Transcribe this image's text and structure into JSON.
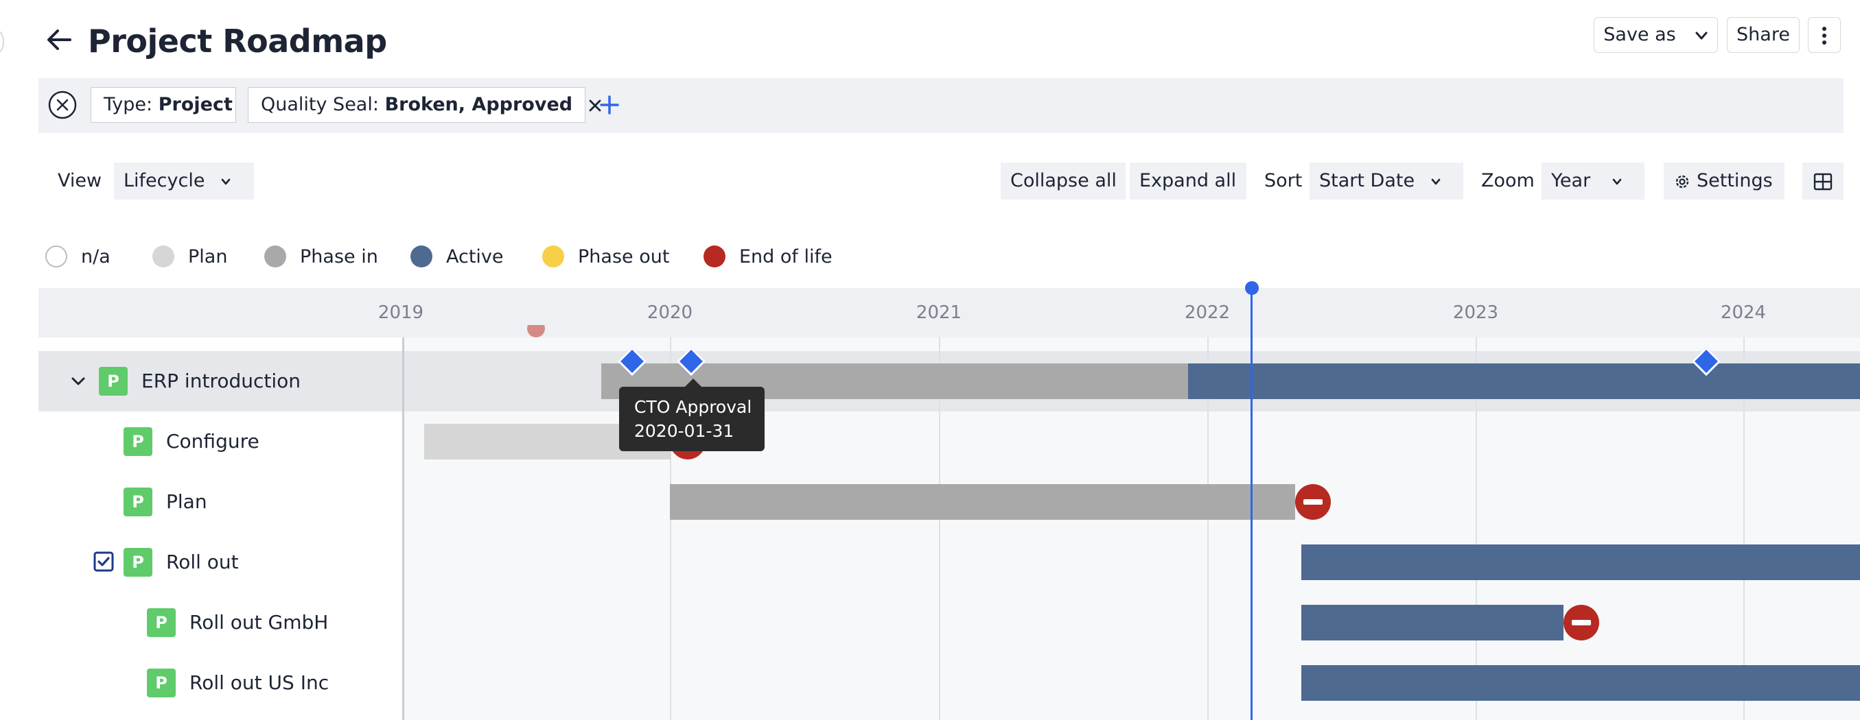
{
  "header": {
    "title": "Project Roadmap",
    "save_as": "Save as",
    "share": "Share"
  },
  "filters": [
    {
      "key": "Type:",
      "value": "Project"
    },
    {
      "key": "Quality Seal:",
      "value": "Broken, Approved"
    }
  ],
  "toolbar": {
    "view_label": "View",
    "view_value": "Lifecycle",
    "collapse_all": "Collapse all",
    "expand_all": "Expand all",
    "sort_label": "Sort",
    "sort_value": "Start Date",
    "zoom_label": "Zoom",
    "zoom_value": "Year",
    "settings": "Settings"
  },
  "legend": [
    {
      "label": "n/a",
      "color": "#ffffff"
    },
    {
      "label": "Plan",
      "color": "#d6d6d6"
    },
    {
      "label": "Phase in",
      "color": "#a9a9a9"
    },
    {
      "label": "Active",
      "color": "#4f6a91"
    },
    {
      "label": "Phase out",
      "color": "#f7cf48"
    },
    {
      "label": "End of life",
      "color": "#b72a22"
    }
  ],
  "timeline": {
    "years": [
      "2019",
      "2020",
      "2021",
      "2022",
      "2023",
      "2024"
    ],
    "today_marker_color": "#2f66e8"
  },
  "rows": [
    {
      "label": "ERP introduction",
      "badge": "P"
    },
    {
      "label": "Configure",
      "badge": "P"
    },
    {
      "label": "Plan",
      "badge": "P"
    },
    {
      "label": "Roll out",
      "badge": "P"
    },
    {
      "label": "Roll out GmbH",
      "badge": "P"
    },
    {
      "label": "Roll out US Inc",
      "badge": "P"
    }
  ],
  "tooltip": {
    "title": "CTO Approval",
    "date": "2020-01-31"
  }
}
